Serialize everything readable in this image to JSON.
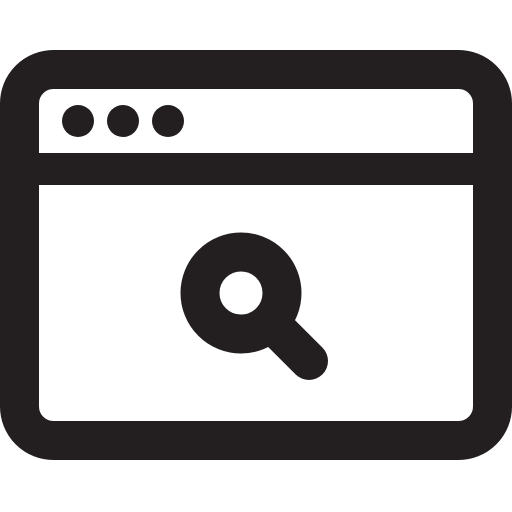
{
  "icon": {
    "name": "browser-search-icon",
    "stroke_color": "#231f20",
    "background_color": "#ffffff",
    "parts": {
      "window_frame": "browser-window-frame",
      "title_bar": "browser-title-bar",
      "dots": [
        "window-dot-1",
        "window-dot-2",
        "window-dot-3"
      ],
      "search": "magnifier-search-icon"
    }
  }
}
